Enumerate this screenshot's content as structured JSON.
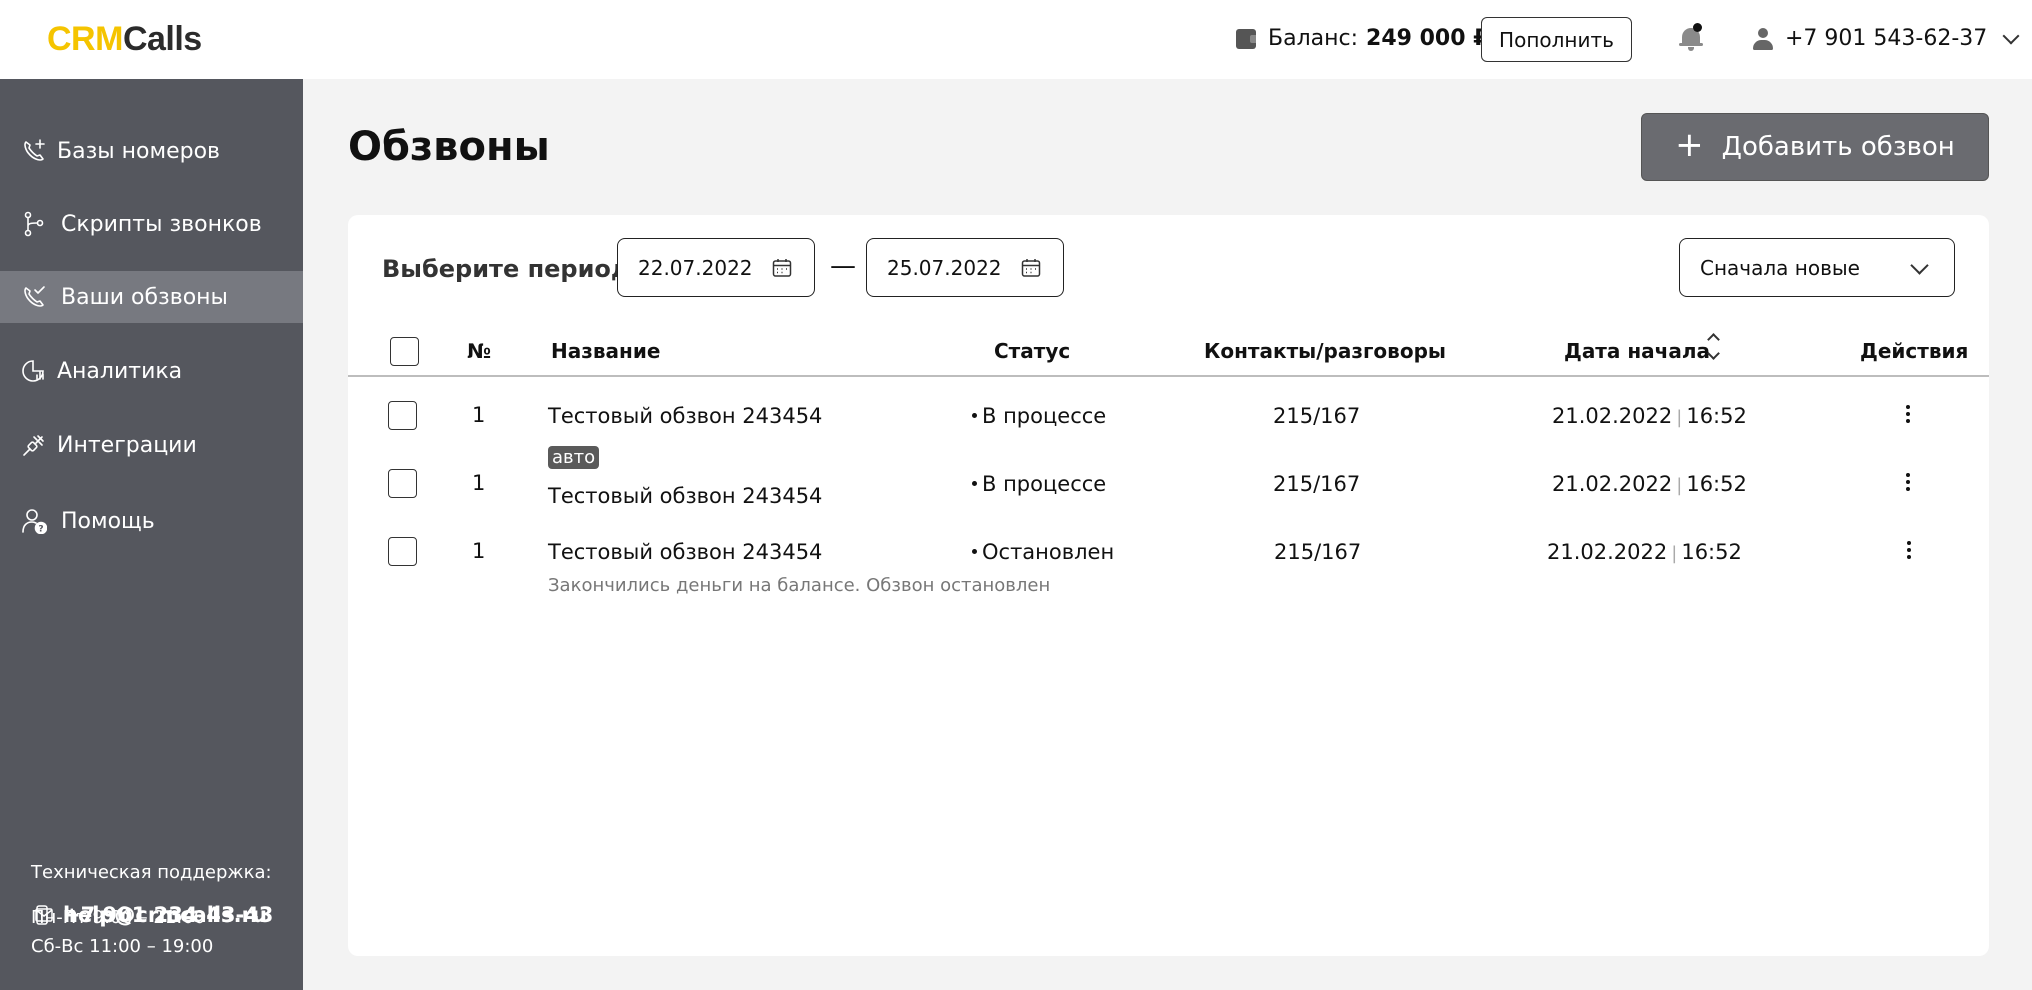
{
  "header": {
    "logo": {
      "part1": "CRM",
      "part2": "Calls"
    },
    "balance_label": "Баланс:",
    "balance_value": "249 000 ₽",
    "topup_label": "Пополнить",
    "user_phone": "+7 901 543-62-37"
  },
  "sidebar": {
    "items": [
      {
        "label": "Базы номеров",
        "icon": "phone-plus-icon"
      },
      {
        "label": "Скрипты звонков",
        "icon": "branch-icon"
      },
      {
        "label": "Ваши обзвоны",
        "icon": "phone-check-icon",
        "active": true
      },
      {
        "label": "Аналитика",
        "icon": "analytics-icon"
      },
      {
        "label": "Интеграции",
        "icon": "integration-icon"
      },
      {
        "label": "Помощь",
        "icon": "help-user-icon"
      }
    ],
    "support": {
      "title": "Техническая поддержка:",
      "phone": "+7 901 234-43-43",
      "email": "help@crmcalls.ru",
      "hours_weekdays": "Пн-Пт 9:00 – 21:00",
      "hours_weekend": "Сб-Вс 11:00 – 19:00"
    }
  },
  "main": {
    "title": "Обзвоны",
    "add_button": "Добавить обзвон",
    "filter": {
      "period_label": "Выберите период",
      "date_from": "22.07.2022",
      "dash": "—",
      "date_to": "25.07.2022",
      "sort_value": "Сначала новые"
    },
    "columns": {
      "number": "№",
      "name": "Название",
      "status": "Статус",
      "contacts": "Контакты/разговоры",
      "start_date": "Дата начала",
      "actions": "Действия"
    },
    "rows": [
      {
        "number": "1",
        "badge": "",
        "name": "Тестовый обзвон 243454",
        "status": "В процессе",
        "contacts": "215/167",
        "date": "21.02.2022",
        "time": "16:52",
        "note": ""
      },
      {
        "number": "1",
        "badge": "авто",
        "name": "Тестовый обзвон 243454",
        "status": "В процессе",
        "contacts": "215/167",
        "date": "21.02.2022",
        "time": "16:52",
        "note": ""
      },
      {
        "number": "1",
        "badge": "",
        "name": "Тестовый обзвон 243454",
        "status": "Остановлен",
        "contacts": "215/167",
        "date": "21.02.2022",
        "time": "16:52",
        "note": "Закончились деньги на балансе. Обзвон остановлен"
      }
    ]
  }
}
